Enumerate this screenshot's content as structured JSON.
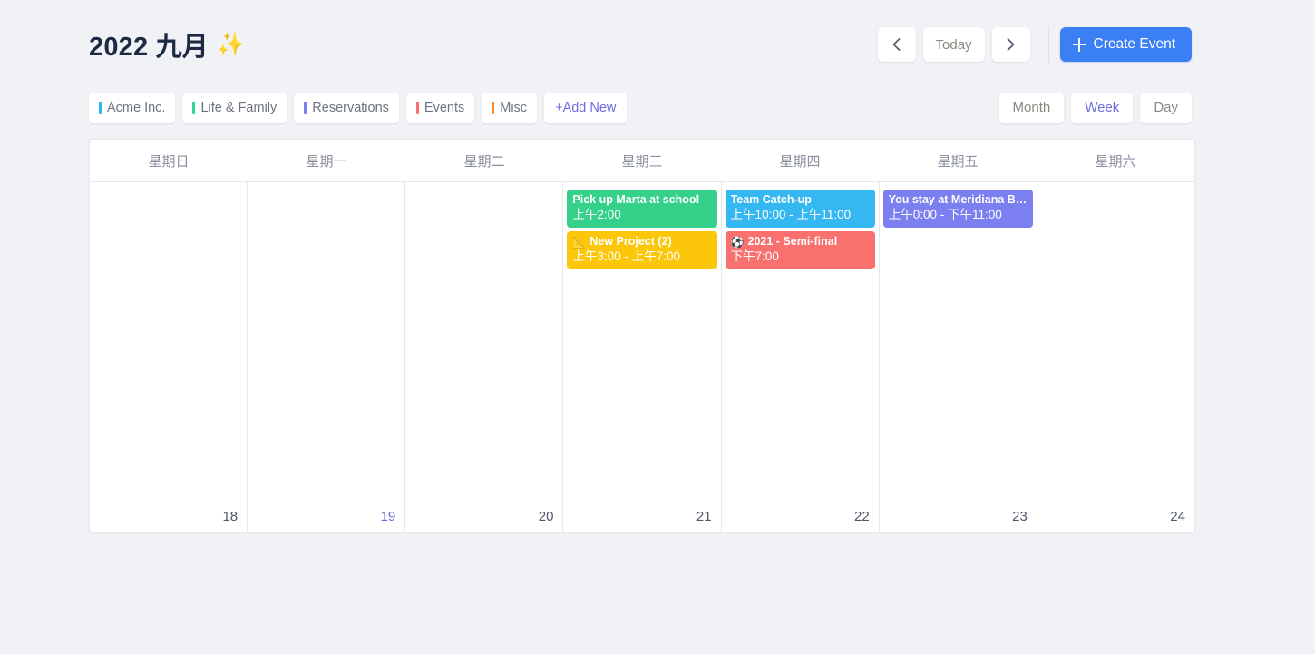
{
  "header": {
    "title": "2022 九月",
    "sparkle_icon": "✨",
    "prev_label": "‹",
    "today_label": "Today",
    "next_label": "›",
    "create_label": "Create Event"
  },
  "filters": {
    "chips": [
      {
        "label": "Acme Inc.",
        "color": "#2eb8f0"
      },
      {
        "label": "Life & Family",
        "color": "#2ed893"
      },
      {
        "label": "Reservations",
        "color": "#7b7ff0"
      },
      {
        "label": "Events",
        "color": "#f9716f"
      },
      {
        "label": "Misc",
        "color": "#fb8c2e"
      }
    ],
    "add_new_label": "+Add New"
  },
  "views": {
    "tabs": [
      {
        "label": "Month",
        "active": false
      },
      {
        "label": "Week",
        "active": true
      },
      {
        "label": "Day",
        "active": false
      }
    ]
  },
  "calendar": {
    "day_headers": [
      "星期日",
      "星期一",
      "星期二",
      "星期三",
      "星期四",
      "星期五",
      "星期六"
    ],
    "days": [
      {
        "date": "18",
        "today": false,
        "events": []
      },
      {
        "date": "19",
        "today": true,
        "events": []
      },
      {
        "date": "20",
        "today": false,
        "events": []
      },
      {
        "date": "21",
        "today": false,
        "events": [
          {
            "title": "Pick up Marta at school",
            "emoji": "",
            "time": "上午2:00",
            "color": "#35d08a"
          },
          {
            "title": "New Project (2)",
            "emoji": "📐",
            "time": "上午3:00 - 上午7:00",
            "color": "#fcc60a"
          }
        ]
      },
      {
        "date": "22",
        "today": false,
        "events": [
          {
            "title": "Team Catch-up",
            "emoji": "",
            "time": "上午10:00 - 上午11:00",
            "color": "#35b8f1"
          },
          {
            "title": "2021 - Semi-final",
            "emoji": "⚽",
            "time": "下午7:00",
            "color": "#f9716f"
          }
        ]
      },
      {
        "date": "23",
        "today": false,
        "events": [
          {
            "title": "You stay at Meridiana B…",
            "emoji": "",
            "time": "上午0:00 - 下午11:00",
            "color": "#7b7ff0"
          }
        ]
      },
      {
        "date": "24",
        "today": false,
        "events": []
      }
    ]
  },
  "colors": {
    "page_background": "#f1f2f6",
    "accent_blue": "#3b7ff5",
    "accent_purple": "#6b6ce0",
    "grid_line": "#e6e8ee",
    "title_text": "#1e2a44"
  }
}
